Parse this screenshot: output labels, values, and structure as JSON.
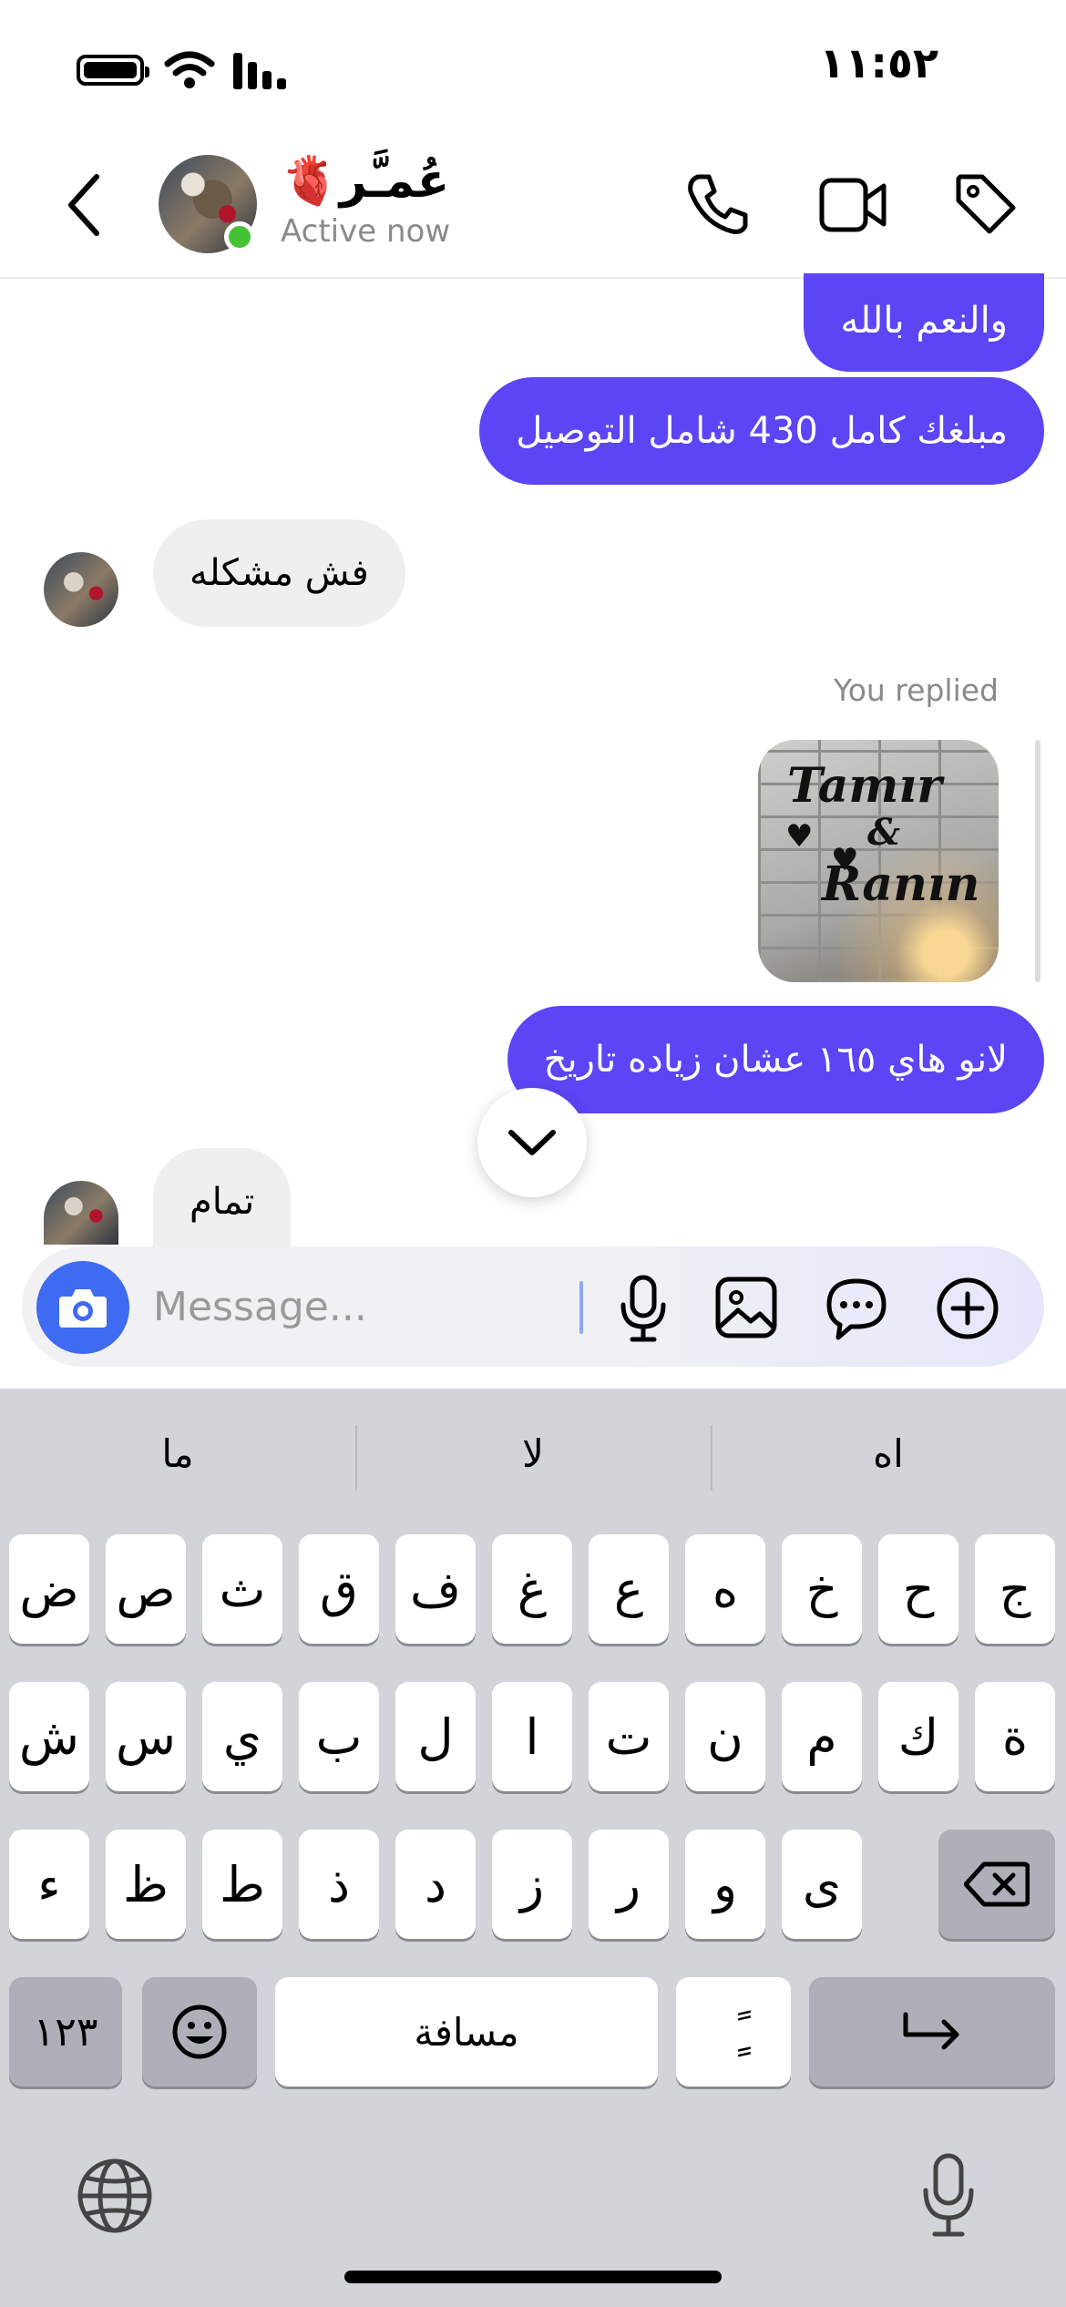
{
  "status_bar": {
    "time": "١١:٥٢"
  },
  "header": {
    "back_icon": "chevron-left-icon",
    "contact_name": "عُمـَّر🫀",
    "status": "Active now",
    "actions": [
      "phone-icon",
      "video-camera-icon",
      "tag-icon"
    ]
  },
  "messages": [
    {
      "side": "out",
      "text": "والنعم بالله"
    },
    {
      "side": "out",
      "text": "مبلغك كامل 430  شامل التوصيل"
    },
    {
      "side": "in",
      "text": "فش مشكله"
    },
    {
      "reply_label": "You replied",
      "image_text_1": "Tamır",
      "image_text_2": "&",
      "image_text_3": "Ranın"
    },
    {
      "side": "out",
      "text": "لانو هاي ١٦٥ عشان زياده تاريخ"
    },
    {
      "side": "in",
      "text": "تمام"
    }
  ],
  "composer": {
    "placeholder": "Message...",
    "icons": [
      "camera-icon",
      "microphone-icon",
      "image-icon",
      "chat-bubble-icon",
      "plus-circle-icon"
    ]
  },
  "keyboard": {
    "suggestions": [
      "ما",
      "لا",
      "اه"
    ],
    "row1": [
      "ض",
      "ص",
      "ث",
      "ق",
      "ف",
      "غ",
      "ع",
      "ه",
      "خ",
      "ح",
      "ج"
    ],
    "row2": [
      "ش",
      "س",
      "ي",
      "ب",
      "ل",
      "ا",
      "ت",
      "ن",
      "م",
      "ك",
      "ة"
    ],
    "row3": [
      "ء",
      "ظ",
      "ط",
      "ذ",
      "د",
      "ز",
      "ر",
      "و",
      "ى"
    ],
    "numbers_key": "١٢٣",
    "space_key": "مسافة",
    "tanween_key": "ًٍ",
    "accent_color": "#5b45f5"
  }
}
